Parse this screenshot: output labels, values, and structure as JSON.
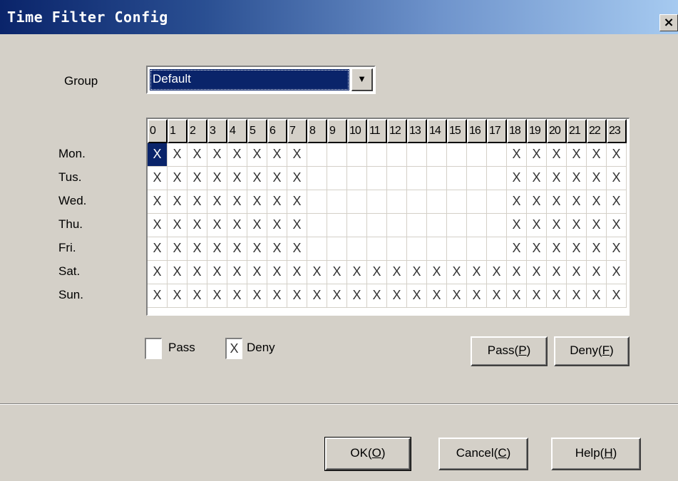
{
  "window": {
    "title": "Time Filter Config",
    "close": "×"
  },
  "group": {
    "label": "Group",
    "value": "Default",
    "dropdown_arrow": "▼"
  },
  "hours": [
    "0",
    "1",
    "2",
    "3",
    "4",
    "5",
    "6",
    "7",
    "8",
    "9",
    "10",
    "11",
    "12",
    "13",
    "14",
    "15",
    "16",
    "17",
    "18",
    "19",
    "20",
    "21",
    "22",
    "23"
  ],
  "days": [
    {
      "label": "Mon.",
      "deny": [
        0,
        1,
        2,
        3,
        4,
        5,
        6,
        7,
        18,
        19,
        20,
        21,
        22,
        23
      ]
    },
    {
      "label": "Tus.",
      "deny": [
        0,
        1,
        2,
        3,
        4,
        5,
        6,
        7,
        18,
        19,
        20,
        21,
        22,
        23
      ]
    },
    {
      "label": "Wed.",
      "deny": [
        0,
        1,
        2,
        3,
        4,
        5,
        6,
        7,
        18,
        19,
        20,
        21,
        22,
        23
      ]
    },
    {
      "label": "Thu.",
      "deny": [
        0,
        1,
        2,
        3,
        4,
        5,
        6,
        7,
        18,
        19,
        20,
        21,
        22,
        23
      ]
    },
    {
      "label": "Fri.",
      "deny": [
        0,
        1,
        2,
        3,
        4,
        5,
        6,
        7,
        18,
        19,
        20,
        21,
        22,
        23
      ]
    },
    {
      "label": "Sat.",
      "deny": [
        0,
        1,
        2,
        3,
        4,
        5,
        6,
        7,
        8,
        9,
        10,
        11,
        12,
        13,
        14,
        15,
        16,
        17,
        18,
        19,
        20,
        21,
        22,
        23
      ]
    },
    {
      "label": "Sun.",
      "deny": [
        0,
        1,
        2,
        3,
        4,
        5,
        6,
        7,
        8,
        9,
        10,
        11,
        12,
        13,
        14,
        15,
        16,
        17,
        18,
        19,
        20,
        21,
        22,
        23
      ]
    }
  ],
  "selected_cell": {
    "day": 0,
    "hour": 0
  },
  "mark": "X",
  "legend": {
    "pass_label": "Pass",
    "deny_label": "Deny",
    "deny_mark": "X"
  },
  "actions": {
    "pass_text": "Pass(",
    "pass_key": "P",
    "deny_text": "Deny(",
    "deny_key": "F",
    "close_paren": ")"
  },
  "footer": {
    "ok_text": "OK(",
    "ok_key": "O",
    "cancel_text": "Cancel(",
    "cancel_key": "C",
    "help_text": "Help(",
    "help_key": "H"
  }
}
